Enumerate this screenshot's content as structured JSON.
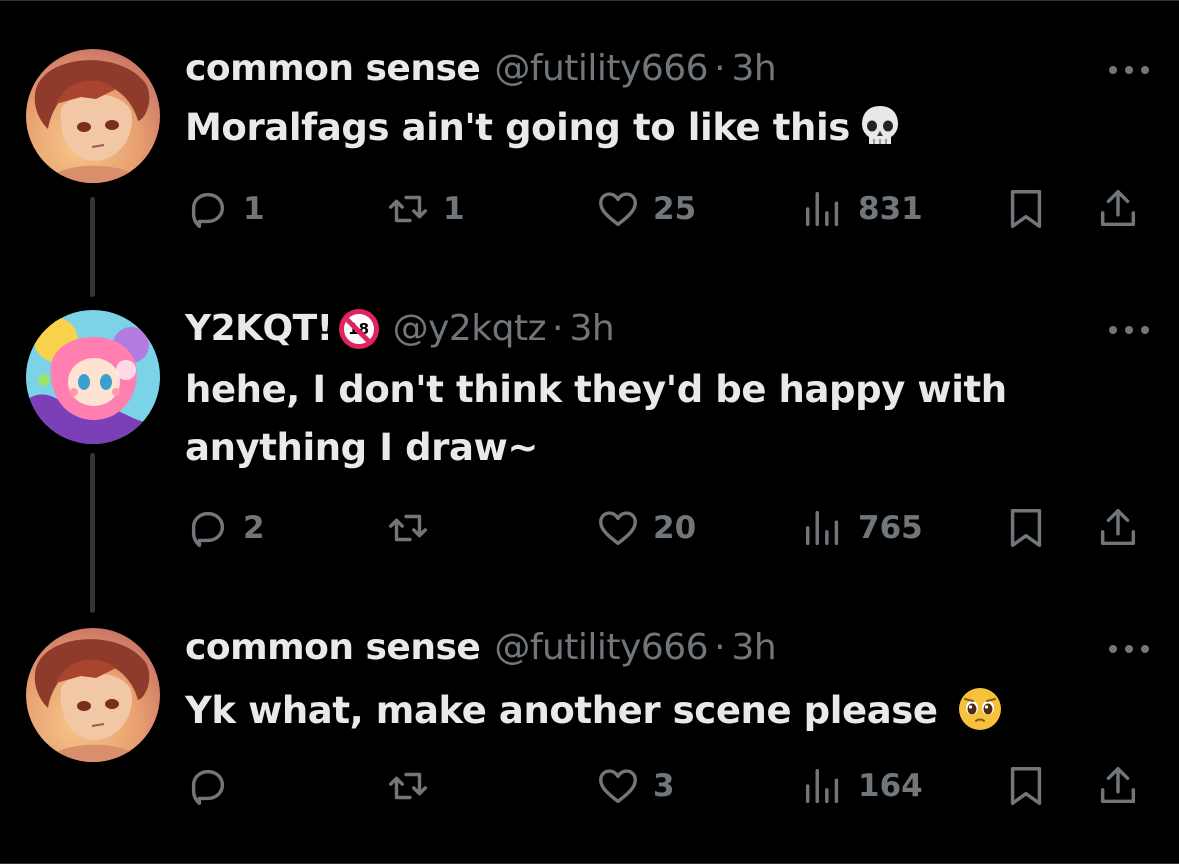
{
  "tweets": [
    {
      "name": "common sense",
      "handle": "@futility666",
      "separator": "·",
      "time": "3h",
      "text": "Moralfags ain't going to like this",
      "emoji": "skull-emoji",
      "replies": "1",
      "reposts": "1",
      "likes": "25",
      "views": "831"
    },
    {
      "name": "Y2KQT!",
      "badge": "18",
      "handle": "@y2kqtz",
      "separator": "·",
      "time": "3h",
      "text": "hehe, I don't think they'd be happy with anything I draw~",
      "replies": "2",
      "reposts": "",
      "likes": "20",
      "views": "765"
    },
    {
      "name": "common sense",
      "handle": "@futility666",
      "separator": "·",
      "time": "3h",
      "text": "Yk what, make another scene please",
      "emoji": "pleading-face-emoji",
      "replies": "",
      "reposts": "",
      "likes": "3",
      "views": "164"
    }
  ],
  "colors": {
    "background": "#000000",
    "text_primary": "#e7e9ea",
    "text_secondary": "#71767b",
    "divider": "#2f3336",
    "badge_red": "#e0245e"
  }
}
